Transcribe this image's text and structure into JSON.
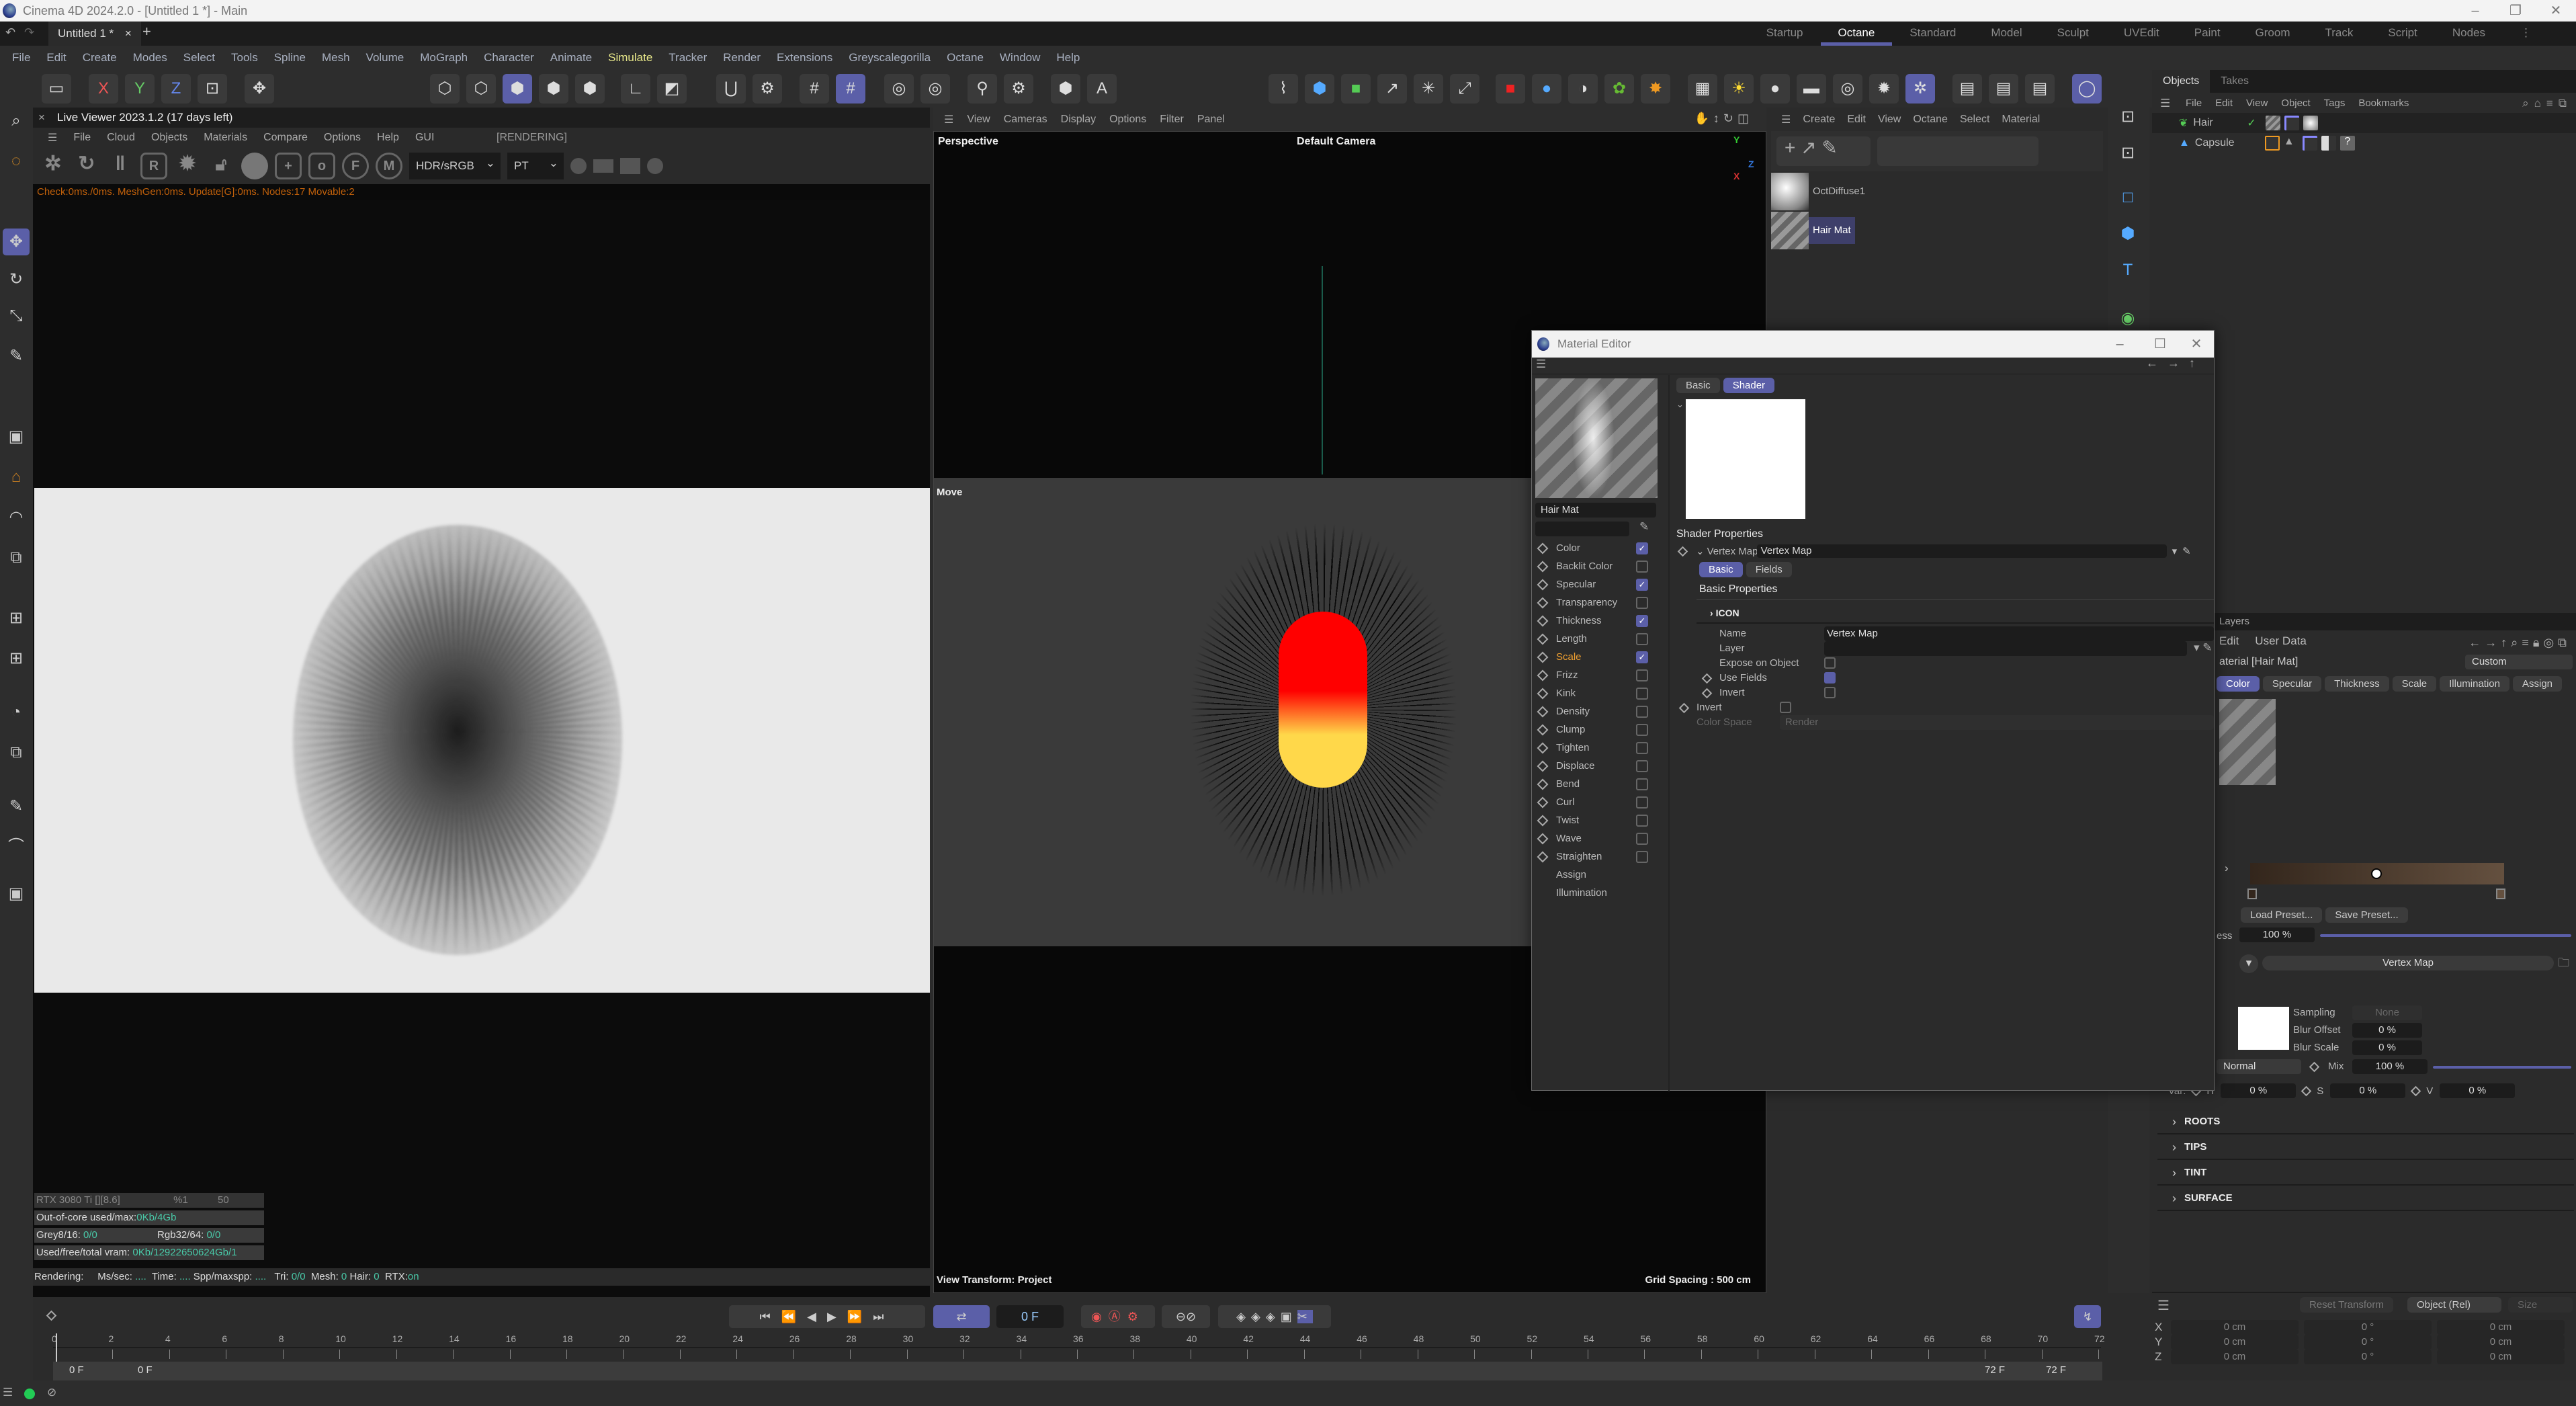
{
  "window": {
    "title": "Cinema 4D 2024.2.0 - [Untitled 1 *] - Main",
    "doc_tab": "Untitled 1 *",
    "close": "×",
    "add": "+"
  },
  "layouts": [
    {
      "label": "Startup"
    },
    {
      "label": "Octane",
      "active": true
    },
    {
      "label": "Standard"
    },
    {
      "label": "Model"
    },
    {
      "label": "Sculpt"
    },
    {
      "label": "UVEdit"
    },
    {
      "label": "Paint"
    },
    {
      "label": "Groom"
    },
    {
      "label": "Track"
    },
    {
      "label": "Script"
    },
    {
      "label": "Nodes"
    }
  ],
  "menu": [
    "File",
    "Edit",
    "Create",
    "Modes",
    "Select",
    "Tools",
    "Spline",
    "Mesh",
    "Volume",
    "MoGraph",
    "Character",
    "Animate",
    "Simulate",
    "Tracker",
    "Render",
    "Extensions",
    "Greyscalegorilla",
    "Octane",
    "Window",
    "Help"
  ],
  "menu_highlight": "Simulate",
  "toolbar": {
    "axis_x": "X",
    "axis_y": "Y",
    "axis_z": "Z"
  },
  "live_viewer": {
    "title": "Live Viewer 2023.1.2 (17 days left)",
    "menu": [
      "File",
      "Cloud",
      "Objects",
      "Materials",
      "Compare",
      "Options",
      "Help",
      "GUI"
    ],
    "state": "[RENDERING]",
    "color_mode": "HDR/sRGB",
    "kernel": "PT",
    "status": "Check:0ms./0ms. MeshGen:0ms. Update[G]:0ms. Nodes:17 Movable:2",
    "gpu": {
      "name": "RTX 3080 Ti [][8.6]",
      "percent": "%1",
      "temp": "50"
    },
    "ooc_label": "Out-of-core used/max:",
    "ooc_value": "0Kb/4Gb",
    "grey_label": "Grey8/16: ",
    "grey_value": "0/0",
    "rgb_label": "Rgb32/64: ",
    "rgb_value": "0/0",
    "vram_label": "Used/free/total vram: ",
    "vram_value": "0Kb/12922650624Gb/1",
    "render_line": {
      "rendering": "Rendering:",
      "mssec": "Ms/sec: ",
      "mssec_v": "....",
      "time": "Time: ",
      "time_v": "....",
      "spp": "Spp/maxspp: ",
      "spp_v": "....",
      "tri": "Tri: ",
      "tri_v": "0/0",
      "mesh": "Mesh: ",
      "mesh_v": "0",
      "hair": "Hair: ",
      "hair_v": "0",
      "rtx": "RTX:",
      "rtx_v": "on"
    }
  },
  "viewport": {
    "menu": [
      "View",
      "Cameras",
      "Display",
      "Options",
      "Filter",
      "Panel"
    ],
    "name": "Perspective",
    "camera": "Default Camera",
    "tool": "Move",
    "transform": "View Transform: Project",
    "grid": "Grid Spacing : 500 cm",
    "axes": {
      "y": "Y",
      "z": "Z",
      "x": "X"
    }
  },
  "material_manager": {
    "menu": [
      "Create",
      "Edit",
      "View",
      "Octane",
      "Select",
      "Material"
    ],
    "materials": [
      {
        "name": "OctDiffuse1"
      },
      {
        "name": "Hair Mat",
        "selected": true
      }
    ]
  },
  "objects": {
    "tabs": [
      "Objects",
      "Takes"
    ],
    "menu": [
      "File",
      "Edit",
      "View",
      "Object",
      "Tags",
      "Bookmarks"
    ],
    "items": [
      {
        "name": "Hair"
      },
      {
        "name": "Capsule"
      }
    ]
  },
  "material_editor": {
    "title": "Material Editor",
    "name": "Hair Mat",
    "tabs": [
      "Basic",
      "Shader"
    ],
    "active_tab": "Shader",
    "channels": [
      {
        "label": "Color",
        "checked": true
      },
      {
        "label": "Backlit Color",
        "checked": false
      },
      {
        "label": "Specular",
        "checked": true
      },
      {
        "label": "Transparency",
        "checked": false
      },
      {
        "label": "Thickness",
        "checked": true
      },
      {
        "label": "Length",
        "checked": false
      },
      {
        "label": "Scale",
        "checked": true,
        "active": true
      },
      {
        "label": "Frizz",
        "checked": false
      },
      {
        "label": "Kink",
        "checked": false
      },
      {
        "label": "Density",
        "checked": false
      },
      {
        "label": "Clump",
        "checked": false
      },
      {
        "label": "Tighten",
        "checked": false
      },
      {
        "label": "Displace",
        "checked": false
      },
      {
        "label": "Bend",
        "checked": false
      },
      {
        "label": "Curl",
        "checked": false
      },
      {
        "label": "Twist",
        "checked": false
      },
      {
        "label": "Wave",
        "checked": false
      },
      {
        "label": "Straighten",
        "checked": false
      },
      {
        "label": "Assign"
      },
      {
        "label": "Illumination"
      }
    ],
    "shader_properties": "Shader Properties",
    "vertex_map_label": "Vertex Map",
    "vertex_map_value": "Vertex Map",
    "sub_tabs": [
      "Basic",
      "Fields"
    ],
    "basic_properties": "Basic Properties",
    "icon_section": "ICON",
    "name_label": "Name",
    "name_value": "Vertex Map",
    "layer_label": "Layer",
    "expose_label": "Expose on Object",
    "expose": false,
    "use_fields_label": "Use Fields",
    "use_fields": true,
    "invert_label": "Invert",
    "invert": false,
    "invert2_label": "Invert",
    "invert2": false,
    "color_space_label": "Color Space",
    "color_space_value": "Render"
  },
  "attributes": {
    "tab": "Layers",
    "menu": [
      "Edit",
      "User Data"
    ],
    "header": "aterial [Hair Mat]",
    "preset": "Custom",
    "tabs": [
      "Color",
      "Specular",
      "Thickness",
      "Scale",
      "Illumination",
      "Assign"
    ],
    "active_tab": "Color",
    "load_preset": "Load Preset...",
    "save_preset": "Save Preset...",
    "brightness_label": "ess",
    "brightness": "100 %",
    "brightness_fraction": 1.0,
    "shader_name": "Vertex Map",
    "sampling_label": "Sampling",
    "sampling": "None",
    "blur_offset_label": "Blur Offset",
    "blur_offset": "0 %",
    "blur_scale_label": "Blur Scale",
    "blur_scale": "0 %",
    "blend": "Normal",
    "mix_label": "Mix",
    "mix": "100 %",
    "mix_fraction": 1.0,
    "var_label": "Var:",
    "h_label": "H",
    "h": "0 %",
    "s_label": "S",
    "s": "0 %",
    "v_label": "V",
    "v": "0 %",
    "gradient_colors": [
      "#33261c",
      "#64503f"
    ],
    "sections": [
      "ROOTS",
      "TIPS",
      "TINT",
      "SURFACE"
    ]
  },
  "coordinates": {
    "reset": "Reset Transform",
    "mode": "Object (Rel)",
    "size_mode": "Size",
    "rows": [
      {
        "axis": "X",
        "pos": "0 cm",
        "rot": "0 °",
        "size": "0 cm"
      },
      {
        "axis": "Y",
        "pos": "0 cm",
        "rot": "0 °",
        "size": "0 cm"
      },
      {
        "axis": "Z",
        "pos": "0 cm",
        "rot": "0 °",
        "size": "0 cm"
      }
    ]
  },
  "timeline": {
    "current_frame": "0 F",
    "start": "0 F",
    "start2": "0 F",
    "end": "72 F",
    "end2": "72 F",
    "ticks": [
      0,
      2,
      4,
      6,
      8,
      10,
      12,
      14,
      16,
      18,
      20,
      22,
      24,
      26,
      28,
      30,
      32,
      34,
      36,
      38,
      40,
      42,
      44,
      46,
      48,
      50,
      52,
      54,
      56,
      58,
      60,
      62,
      64,
      66,
      68,
      70,
      72
    ]
  },
  "colors": {
    "accent": "#5b5fa8",
    "highlight": "#e8e88a",
    "warn": "#c0600a",
    "cyan": "#49c9a8"
  }
}
